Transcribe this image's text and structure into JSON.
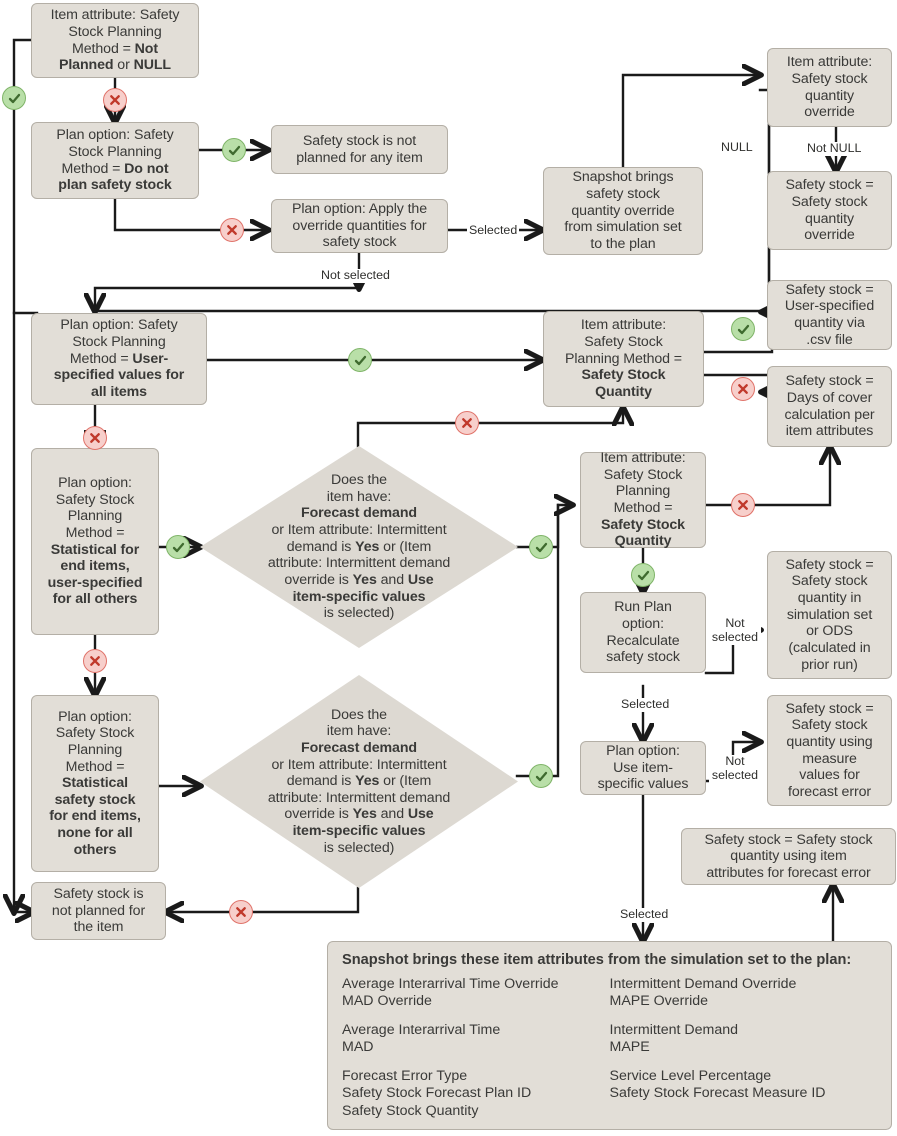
{
  "diagram": {
    "title": "Safety stock planning method decision flow",
    "colors": {
      "node_fill": "#e2ded7",
      "node_border": "#b4afa6",
      "diamond_fill": "#ddd9d2",
      "edge": "#1a1a1a",
      "yes_badge_fill": "#b9dfa8",
      "yes_badge_border": "#7fb468",
      "no_badge_fill": "#f7cfcb",
      "no_badge_border": "#e0736a",
      "text": "#3a3a38",
      "background": "#ffffff"
    }
  },
  "nodes": {
    "item_not_planned": {
      "lines": [
        "Item attribute: Safety",
        "Stock Planning",
        "Method = <b>Not</b>",
        "<b>Planned</b> or <b>NULL</b>"
      ],
      "plain": "Item attribute: Safety Stock Planning Method = Not Planned or NULL"
    },
    "plan_do_not_plan": {
      "lines": [
        "Plan option: Safety",
        "Stock Planning",
        "Method = <b>Do not</b>",
        "<b>plan safety stock</b>"
      ],
      "plain": "Plan option: Safety Stock Planning Method = Do not plan safety stock"
    },
    "ss_not_planned_any": {
      "lines": [
        "Safety stock is not",
        "planned for any item"
      ],
      "plain": "Safety stock is not planned for any item"
    },
    "apply_override_qty": {
      "lines": [
        "Plan option: Apply the",
        "override quantities for",
        "safety stock"
      ],
      "plain": "Plan option: Apply the override quantities for safety stock"
    },
    "snapshot_override": {
      "lines": [
        "Snapshot brings",
        "safety stock",
        "quantity override",
        "from simulation set",
        "to the plan"
      ],
      "plain": "Snapshot brings safety stock quantity override from simulation set to the plan"
    },
    "item_ss_qty_override": {
      "lines": [
        "Item attribute:",
        "Safety stock",
        "quantity",
        "override"
      ],
      "plain": "Item attribute: Safety stock quantity override"
    },
    "ss_equals_override": {
      "lines": [
        "Safety stock =",
        "Safety stock",
        "quantity",
        "override"
      ],
      "plain": "Safety stock = Safety stock quantity override"
    },
    "plan_user_specified": {
      "lines": [
        "Plan option: Safety",
        "Stock Planning",
        "Method = <b>User-</b>",
        "<b>specified values for</b>",
        "<b>all items</b>"
      ],
      "plain": "Plan option: Safety Stock Planning Method = User-specified values for all items"
    },
    "item_ssqty_top": {
      "lines": [
        "Item attribute:",
        "Safety Stock",
        "Planning Method =",
        "<b>Safety Stock</b>",
        "<b>Quantity</b>"
      ],
      "plain": "Item attribute: Safety Stock Planning Method = Safety Stock Quantity"
    },
    "ss_user_csv": {
      "lines": [
        "Safety stock =",
        "User-specified",
        "quantity via",
        ".csv file"
      ],
      "plain": "Safety stock = User-specified quantity via .csv file"
    },
    "ss_days_cover": {
      "lines": [
        "Safety stock =",
        "Days of cover",
        "calculation per",
        "item attributes"
      ],
      "plain": "Safety stock = Days of cover calculation per item attributes"
    },
    "plan_stat_end_user": {
      "lines": [
        "Plan option:",
        "Safety Stock",
        "Planning",
        "Method =",
        "<b>Statistical for</b>",
        "<b>end items,</b>",
        "<b>user-specified</b>",
        "<b>for all others</b>"
      ],
      "plain": "Plan option: Safety Stock Planning Method = Statistical for end items, user-specified for all others"
    },
    "plan_stat_none": {
      "lines": [
        "Plan option:",
        "Safety Stock",
        "Planning",
        "Method =",
        "<b>Statistical</b>",
        "<b>safety stock</b>",
        "<b>for end items,</b>",
        "<b>none for all</b>",
        "<b>others</b>"
      ],
      "plain": "Plan option: Safety Stock Planning Method = Statistical safety stock for end items, none for all others"
    },
    "decision_upper": {
      "lines": [
        "Does the",
        "item have:",
        "<b>Forecast demand</b>",
        "or Item attribute: Intermittent",
        "demand is <b>Yes</b> or (Item",
        "attribute: Intermittent demand",
        "override is <b>Yes</b> and <b>Use</b>",
        "<b>item-specific values</b>",
        "is selected)"
      ],
      "plain": "Does the item have: Forecast demand or Item attribute: Intermittent demand is Yes or (Item attribute: Intermittent demand override is Yes and Use item-specific values is selected)"
    },
    "decision_lower": {
      "lines": [
        "Does the",
        "item have:",
        "<b>Forecast demand</b>",
        "or Item attribute: Intermittent",
        "demand is <b>Yes</b> or (Item",
        "attribute: Intermittent demand",
        "override is <b>Yes</b> and <b>Use</b>",
        "<b>item-specific values</b>",
        "is selected)"
      ],
      "plain": "Does the item have: Forecast demand or Item attribute: Intermittent demand is Yes or (Item attribute: Intermittent demand override is Yes and Use item-specific values is selected)"
    },
    "item_ssqty_mid": {
      "lines": [
        "Item attribute:",
        "Safety Stock",
        "Planning",
        "Method =",
        "<b>Safety Stock</b>",
        "<b>Quantity</b>"
      ],
      "plain": "Item attribute: Safety Stock Planning Method = Safety Stock Quantity"
    },
    "run_plan_recalc": {
      "lines": [
        "Run Plan",
        "option:",
        "Recalculate",
        "safety stock"
      ],
      "plain": "Run Plan option: Recalculate safety stock"
    },
    "ss_simset_ods": {
      "lines": [
        "Safety stock =",
        "Safety stock",
        "quantity in",
        "simulation set",
        "or ODS",
        "(calculated in",
        "prior run)"
      ],
      "plain": "Safety stock = Safety stock quantity in simulation set or ODS (calculated in prior run)"
    },
    "plan_use_item_specific": {
      "lines": [
        "Plan option:",
        "Use item-",
        "specific values"
      ],
      "plain": "Plan option: Use item-specific values"
    },
    "ss_measure_values": {
      "lines": [
        "Safety stock =",
        "Safety stock",
        "quantity using",
        "measure",
        "values for",
        "forecast error"
      ],
      "plain": "Safety stock = Safety stock quantity using measure values for forecast error"
    },
    "ss_item_attrs": {
      "lines": [
        "Safety stock = Safety stock",
        "quantity using item",
        "attributes for forecast error"
      ],
      "plain": "Safety stock = Safety stock quantity using item attributes for forecast error"
    },
    "ss_not_planned_item": {
      "lines": [
        "Safety stock is",
        "not planned for",
        "the item"
      ],
      "plain": "Safety stock is not planned for the item"
    }
  },
  "edge_labels": {
    "selected_to_snapshot": "Selected",
    "not_selected_override": "Not selected",
    "null_label": "NULL",
    "not_null_label": "Not NULL",
    "not_selected_recalc": [
      "Not",
      "selected"
    ],
    "selected_recalc": "Selected",
    "not_selected_itemspec": [
      "Not",
      "selected"
    ],
    "selected_itemspec": "Selected"
  },
  "badges": {
    "yes_icon": "check-icon",
    "no_icon": "cross-icon"
  },
  "panel": {
    "title": "Snapshot brings these item attributes from the simulation set to the plan:",
    "left_groups": [
      [
        "Average Interarrival Time Override",
        "MAD Override"
      ],
      [
        "Average Interarrival Time",
        "MAD"
      ],
      [
        "Forecast Error Type",
        "Safety Stock Forecast Plan ID",
        "Safety Stock Quantity"
      ]
    ],
    "right_groups": [
      [
        "Intermittent Demand Override",
        "MAPE Override"
      ],
      [
        "Intermittent Demand",
        "MAPE"
      ],
      [
        "Service Level Percentage",
        "Safety Stock Forecast Measure ID"
      ]
    ]
  }
}
